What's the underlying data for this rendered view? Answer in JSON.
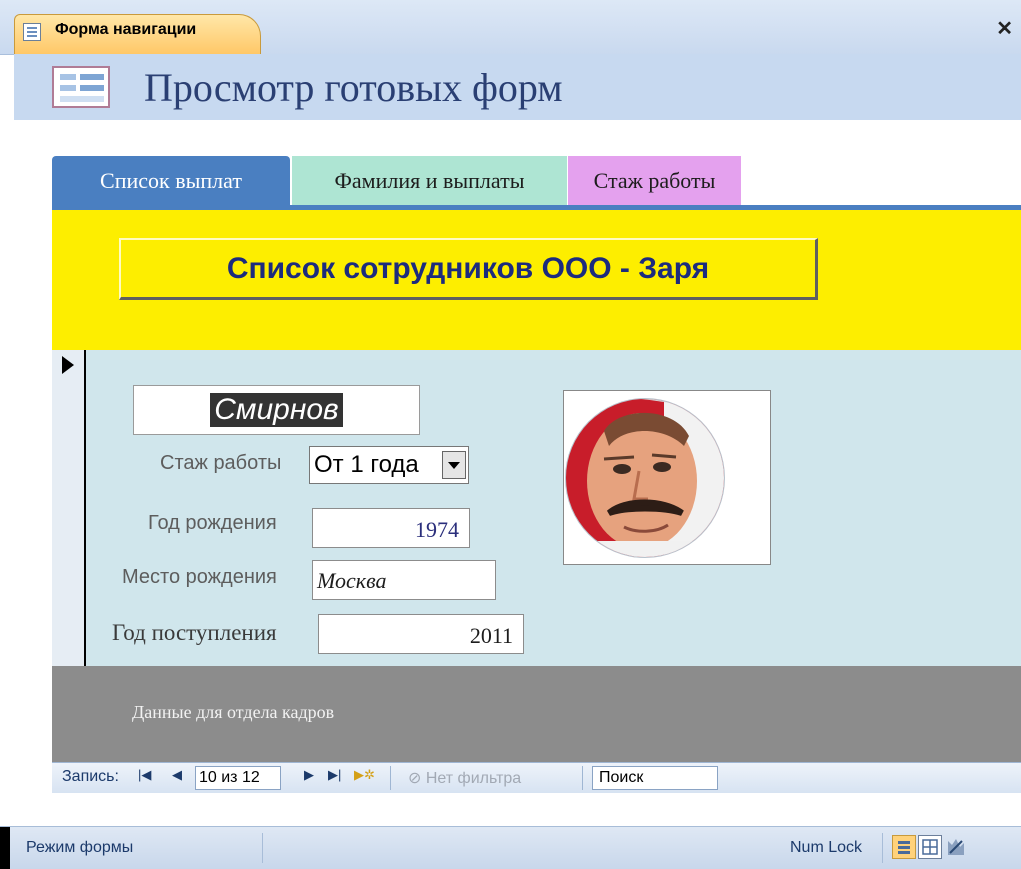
{
  "document_tab": {
    "title": "Форма навигации"
  },
  "header": {
    "title": "Просмотр готовых форм"
  },
  "nav_tabs": [
    {
      "label": "Список выплат",
      "color": "#4a7fc1"
    },
    {
      "label": "Фамилия и выплаты",
      "color": "#aee5d3"
    },
    {
      "label": "Стаж работы",
      "color": "#e4a1ee"
    }
  ],
  "form": {
    "banner": "Список сотрудников ООО - Заря",
    "name": "Смирнов",
    "experience": {
      "label": "Стаж работы",
      "value": "От 1 года"
    },
    "birth_year": {
      "label": "Год рождения",
      "value": "1974"
    },
    "birth_place": {
      "label": "Место рождения",
      "value": "Москва"
    },
    "hire_year": {
      "label": "Год поступления",
      "value": "2011"
    },
    "footer": "Данные для отдела кадров"
  },
  "record_nav": {
    "label": "Запись:",
    "counter": "10 из 12",
    "filter": "Нет фильтра",
    "search": "Поиск"
  },
  "status_bar": {
    "mode": "Режим формы",
    "numlock": "Num Lock"
  }
}
